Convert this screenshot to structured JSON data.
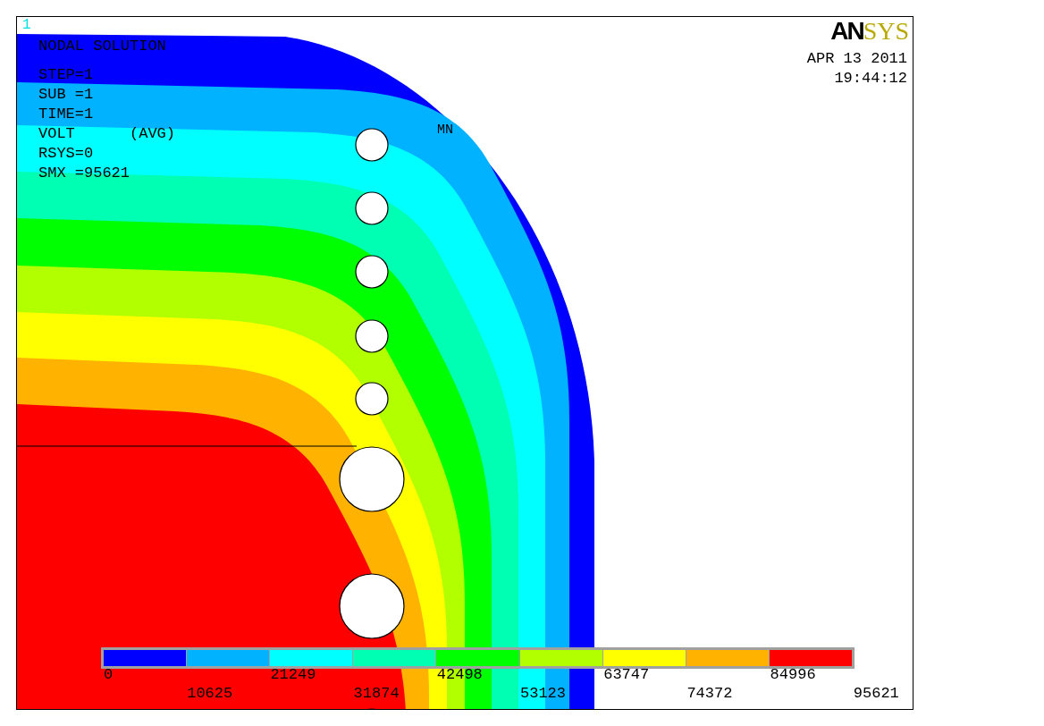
{
  "window": {
    "number": "1"
  },
  "logo": {
    "part_1": "AN",
    "part_2": "SYS"
  },
  "date": "APR 13 2011",
  "time": "19:44:12",
  "info": [
    "NODAL SOLUTION",
    "STEP=1",
    "SUB =1",
    "TIME=1",
    "VOLT      (AVG)",
    "RSYS=0",
    "SMX =95621"
  ],
  "plot_label": "MN",
  "legend": {
    "bands": [
      {
        "color": "#0000ff"
      },
      {
        "color": "#00b2ff"
      },
      {
        "color": "#00ffff"
      },
      {
        "color": "#00ffb2"
      },
      {
        "color": "#00ff00"
      },
      {
        "color": "#b2ff00"
      },
      {
        "color": "#ffff00"
      },
      {
        "color": "#ffb200"
      },
      {
        "color": "#ff0000"
      }
    ],
    "labels": [
      "0",
      "10625",
      "21249",
      "31874",
      "42498",
      "53123",
      "63747",
      "74372",
      "84996",
      "95621"
    ]
  }
}
